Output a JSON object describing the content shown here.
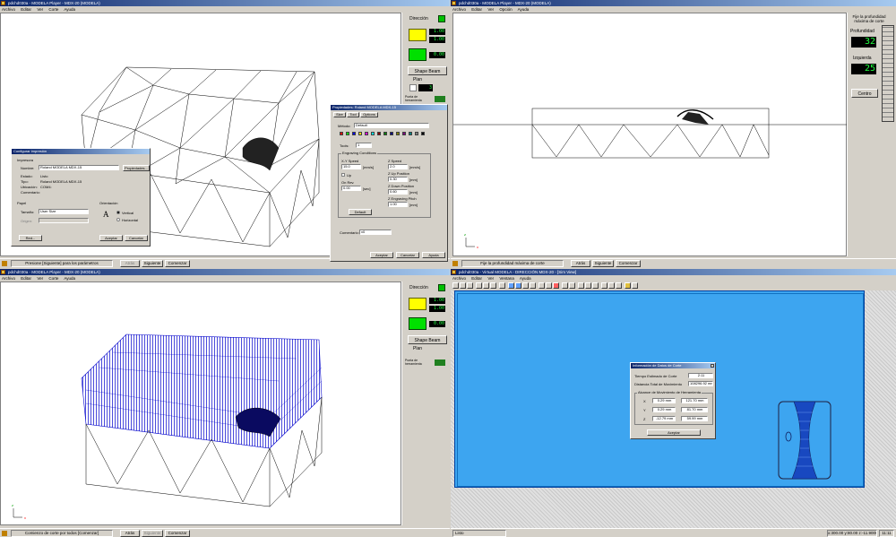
{
  "q1": {
    "title": "pdchd030a - MODELA Player - MDX-20 (MODELA)",
    "menu": [
      "Archivo",
      "Editar",
      "Ver",
      "Corte",
      "Ayuda"
    ],
    "side": {
      "direccion": "Dirección",
      "shape_btn": "Shape Beam",
      "lcd_top": "1.00",
      "lcd_mid": "1.00",
      "lcd_bottom": "0.00",
      "plan_label": "Plan",
      "plan_value": "3",
      "tool_label": "Punta de herramienta"
    },
    "status": {
      "message": "Presione [Siguiente] para los parámetros",
      "back": "Atrás",
      "next": "Siguiente",
      "start": "Comenzar"
    },
    "print_dialog": {
      "title": "Configurar impresión",
      "printer_group": "Impresora",
      "name_label": "Nombre:",
      "name_value": "Roland MODELA MDX-15",
      "properties": "Propiedades...",
      "state_label": "Estado:",
      "state_value": "Listo",
      "type_label": "Tipo:",
      "type_value": "Roland MODELA MDX-15",
      "location_label": "Ubicación:",
      "location_value": "COM4:",
      "comment_label": "Comentario:",
      "paper_group": "Papel",
      "size_label": "Tamaño:",
      "size_value": "User Size",
      "source_label": "Origen:",
      "orient_group": "Orientación",
      "vertical": "Vertical",
      "horizontal": "Horizontal",
      "net": "Red...",
      "accept": "Aceptar",
      "cancel": "Cancelar"
    },
    "props_dialog": {
      "title": "Propiedades: Roland MODELA MDX-15",
      "tabs": [
        "Size",
        "Tool",
        "Options"
      ],
      "method_label": "Método:",
      "method_value": "Default",
      "tools_label": "Tools:",
      "tools_value": "1",
      "engrave_group": "Engraving Conditions",
      "xy_speed": "X-Y Speed",
      "xy_value": "15.0",
      "xy_unit": "[mm/s]",
      "z_speed": "Z Speed",
      "z_value": "2.0",
      "z_unit": "[mm/s]",
      "z_up": "Z Up Position",
      "z_up_value": "0.30",
      "mm": "[mm]",
      "z_down": "Z Down Position",
      "z_down_value": "0.60",
      "z_engrave": "Z Engraving Pitch",
      "z_engrave_value": "1.00",
      "on_rpm": "On Rev.",
      "rpm_value": "0.00",
      "sec": "[sec]",
      "up_label": "Up",
      "default_btn": "Default",
      "comment_label": "Comentario:",
      "comment_value": "x0",
      "accept": "Aceptar",
      "cancel": "Cancelar",
      "help": "Ayuda"
    }
  },
  "q2": {
    "title": "pdchd030a - MODELA Player - MDX-20 (MODELA)",
    "menu": [
      "Archivo",
      "Editar",
      "Ver",
      "Opción",
      "Ayuda"
    ],
    "side": {
      "hint": "Fije la profundidad máxima de corte",
      "depth_label": "Profundidad",
      "depth_value": "32",
      "left_label": "Izquierda",
      "left_value": "25",
      "center": "Centro"
    },
    "status": {
      "message": "Fije la profundidad máxima de corte",
      "back": "Atrás",
      "next": "Siguiente",
      "start": "Comenzar"
    }
  },
  "q3": {
    "title": "pdchd030a - MODELA Player - MDX-20 (MODELA)",
    "menu": [
      "Archivo",
      "Editar",
      "Ver",
      "Corte",
      "Ayuda"
    ],
    "side": {
      "direccion": "Dirección",
      "shape_btn": "Shape Beam",
      "lcd_top": "1.00",
      "lcd_mid": "1.00",
      "lcd_bottom": "0.00",
      "plan_label": "Plan",
      "tool_label": "Punta de herramienta"
    },
    "status": {
      "message": "Comienzo de corte por todos [Comenzar]",
      "back": "Atrás",
      "next": "Siguiente",
      "start": "Comenzar"
    }
  },
  "q4": {
    "title": "pdchd030a - Virtual MODELA - DIRECCIÓN MDX-20 - [Sim View]",
    "menu": [
      "Archivo",
      "Editar",
      "Ver",
      "Ventana",
      "Ayuda"
    ],
    "status": {
      "left": "Listo",
      "coords": "x:300.00 y:80.00 z:-11.9000",
      "right": "11:11"
    },
    "info_dialog": {
      "title": "Información de Datos de Corte",
      "time_label": "Tiempo Estimado de Corte",
      "time_value": "2:11",
      "dist_label": "Distancia Total de Movimiento",
      "dist_value": "108296.92 mm",
      "range_group": "Alcance de Movimiento de Herramienta",
      "rows": [
        {
          "axis": "X",
          "min": "0.29 mm",
          "max": "121.70 mm"
        },
        {
          "axis": "Y",
          "min": "0.29 mm",
          "max": "81.70 mm"
        },
        {
          "axis": "Z",
          "min": "-12.79 mm",
          "max": "59.99 mm"
        }
      ],
      "accept": "Aceptar"
    }
  },
  "colors": {
    "title_start": "#0a246a",
    "title_end": "#a6caf0",
    "sim_blue": "#3da5f0",
    "toolpath": "#0000cc",
    "lcd": "#20ff40"
  }
}
